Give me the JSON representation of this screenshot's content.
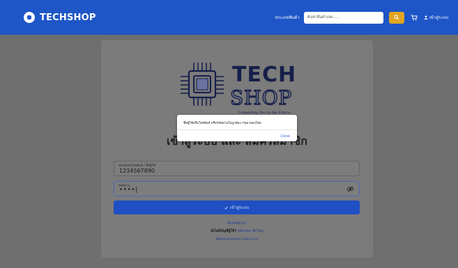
{
  "navbar": {
    "brand": "TECHSHOP",
    "brand_icon": "logo-icon",
    "category_link": "ประเภทสินค้า",
    "search_placeholder": "ค้นหาสินค้าเลย......",
    "search_icon": "search-icon",
    "cart_icon": "cart-icon",
    "login_label": "เข้าสู่ระบบ",
    "user_icon": "user-icon"
  },
  "logo": {
    "line1": "TECH",
    "line2": "SHOP",
    "tagline": "Connecting You to the Future"
  },
  "form": {
    "heading": "เข้าสู่ระบบ และ สมัครสมาชิก",
    "username_label": "หมายเลขโทรศัพท์ / ชื่อผู้ใช้",
    "username_value": "1234567890",
    "password_label": "รหัสผ่าน",
    "password_value": "••••|",
    "eye_icon": "eye-slash-icon",
    "submit_label": "เข้าสู่ระบบ",
    "submit_icon": "check-icon",
    "forgot_link": "ลืมรหัสผ่าน?",
    "register_prompt": "ยังไม่มีบัญชีผู้ใช้?",
    "register_link": "สมัครสมาชิกใหม่",
    "admin_link": "Administration (พนักงาน)"
  },
  "modal": {
    "message": "ชื่อผู้ใช้หรือโทรศัพท์ หรือรหัสผ่านไม่ถูกต้อง กรุณาลองใหม่",
    "close_label": "Close"
  },
  "colors": {
    "navbar": "#1e56c7",
    "search_button": "#e0a521",
    "primary_button": "#1f4fc2",
    "link": "#2a64d6"
  }
}
